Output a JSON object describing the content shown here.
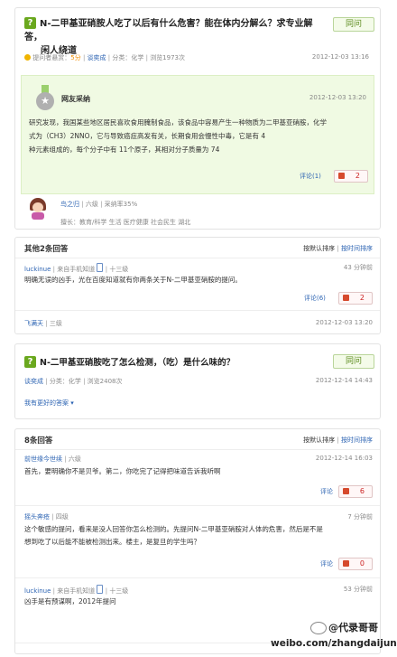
{
  "q1": {
    "title_line1": "N-二甲基亚硝胺人吃了以后有什么危害？能在体内分解么？求专业解答，",
    "title_line2": "闲人绕道",
    "btn": "同问",
    "meta_bounty_label": "提问者悬赏：",
    "meta_bounty_val": "5分",
    "meta_sep": "|",
    "meta_user": "谈奕成",
    "meta_cat": "分类：化学",
    "meta_views": "浏览1973次",
    "time": "2012-12-03 13:16"
  },
  "best": {
    "label": "网友采纳",
    "time": "2012-12-03 13:20",
    "body_l1": "研究发现，我国某些地区居民喜欢食用腌制食品，该食品中容易产生一种物质为二甲基亚硝胺，化学",
    "body_l2": "式为（CH3）2NNO，它与导致癌症高发有关，长期食用会慢性中毒，它是有 4",
    "body_l3": "种元素组成的，每个分子中有 11个原子，其相对分子质量为 74",
    "comment": "评论(1)",
    "likes": "2",
    "user": "鸟之归",
    "level": "六级",
    "adopt": "采纳率35%",
    "expertise": "擅长：教育/科学 生活 医疗健康 社会民生 湖北"
  },
  "others": {
    "title": "其他2条回答",
    "sort_default": "按默认排序",
    "sort_time": "按时间排序",
    "a1_user": "luckinue",
    "a1_via": "来自手机知道",
    "a1_level": "十三级",
    "a1_time": "43 分钟前",
    "a1_body": "明确无误的凶手，光在百度知道就有你两条关于N-二甲基亚硝胺的提问。",
    "a1_comment": "评论(6)",
    "a1_likes": "2",
    "a2_user": "飞满天",
    "a2_level": "三级",
    "a2_time": "2012-12-03 13:20"
  },
  "q2": {
    "title": "N-二甲基亚硝胺吃了怎么检测，（吃）是什么味的？",
    "btn": "同问",
    "meta_user": "谈奕成",
    "meta_cat": "分类：化学",
    "meta_views": "浏览2408次",
    "time": "2012-12-14 14:43",
    "better": "我有更好的答案"
  },
  "answers": {
    "title": "8条回答",
    "sort_default": "按默认排序",
    "sort_time": "按时间排序",
    "r1_user": "前世缘今世续",
    "r1_level": "六级",
    "r1_time": "2012-12-14 16:03",
    "r1_body": "首先，要明确你不是贝爷。第二，你吃完了记得把味道告诉我听啊",
    "r1_comment": "评论",
    "r1_likes": "6",
    "r2_user": "摇头奔疮",
    "r2_level": "四级",
    "r2_time": "7 分钟前",
    "r2_body_l1": "这个敏感的提问，看来是没人回答你怎么检测的。先提问N-二甲基亚硝胺对人体的危害，然后是不是",
    "r2_body_l2": "想到吃了以后能不能被检测出来。楼主，是复旦的学生吗？",
    "r2_comment": "评论",
    "r2_likes": "0",
    "r3_user": "luckinue",
    "r3_via": "来自手机知道",
    "r3_level": "十三级",
    "r3_time": "53 分钟前",
    "r3_body": "凶手是有预谋啊，2012年提问"
  },
  "watermark": {
    "handle": "@代录哥哥",
    "site": "weibo.com/zhangdaijuni"
  }
}
